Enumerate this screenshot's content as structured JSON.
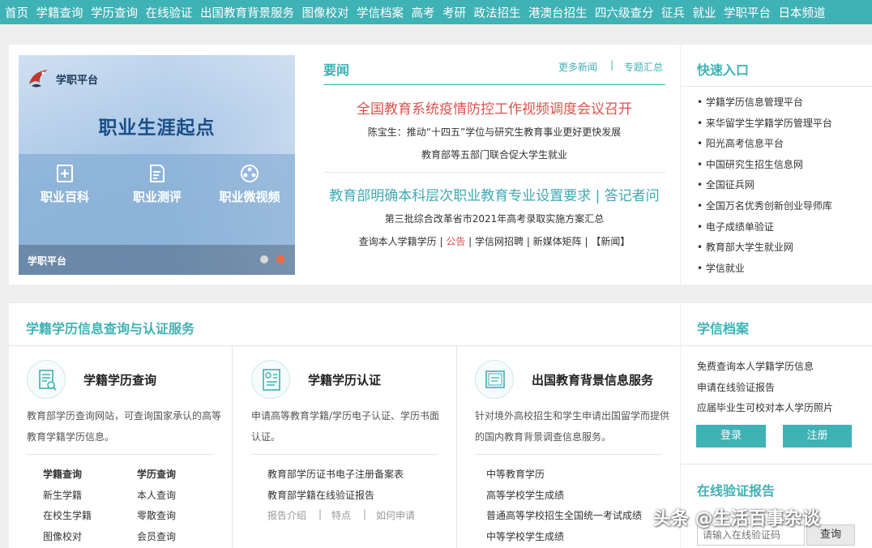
{
  "topnav": [
    "首页",
    "学籍查询",
    "学历查询",
    "在线验证",
    "出国教育背景服务",
    "图像校对",
    "学信档案",
    "高考",
    "考研",
    "政法招生",
    "港澳台招生",
    "四六级查分",
    "征兵",
    "就业",
    "学职平台",
    "日本频道"
  ],
  "banner": {
    "logo_text": "学职平台",
    "slogan": "职业生涯起点",
    "items": [
      "职业百科",
      "职业测评",
      "职业微视频"
    ],
    "footer": "学职平台"
  },
  "news": {
    "title": "要闻",
    "more": "更多新闻",
    "separator": "|",
    "topics": "专题汇总",
    "headline1": "全国教育系统疫情防控工作视频调度会议召开",
    "sub1": "陈宝生：推动“十四五”学位与研究生教育事业更好更快发展",
    "sub2": "教育部等五部门联合促大学生就业",
    "headline2": "教育部明确本科层次职业教育专业设置要求 | 答记者问",
    "sub3": "第三批综合改革省市2021年高考录取实施方案汇总",
    "links": [
      "查询本人学籍学历",
      " | ",
      "公告",
      " | 学信网招聘 | 新媒体矩阵 | ",
      "【新闻】"
    ]
  },
  "quick": {
    "title": "快速入口",
    "items": [
      "• 学籍学历信息管理平台",
      "• 来华留学生学籍学历管理平台",
      "• 阳光高考信息平台",
      "• 中国研究生招生信息网",
      "• 全国征兵网",
      "• 全国万名优秀创新创业导师库",
      "• 电子成绩单验证",
      "• 教育部大学生就业网",
      "• 学信就业"
    ]
  },
  "service": {
    "title": "学籍学历信息查询与认证服务",
    "cols": [
      {
        "title": "学籍学历查询",
        "desc": "教育部学历查询网站，可查询国家承认的高等教育学籍学历信息。",
        "links_a": [
          "学籍查询",
          "新生学籍",
          "在校生学籍",
          "图像校对"
        ],
        "links_b": [
          "学历查询",
          "本人查询",
          "零散查询",
          "会员查询"
        ]
      },
      {
        "title": "学籍学历认证",
        "desc": "申请高等教育学籍/学历电子认证、学历书面认证。",
        "links": [
          "教育部学历证书电子注册备案表",
          "教育部学籍在线验证报告"
        ],
        "sublinks": [
          "报告介绍",
          "|",
          "特点",
          "|",
          "如何申请"
        ]
      },
      {
        "title": "出国教育背景信息服务",
        "desc": "针对境外高校招生和学生申请出国留学而提供的国内教育背景调查信息服务。",
        "links": [
          "中等教育学历",
          "高等学校学生成绩",
          "普通高等学校招生全国统一考试成绩",
          "中等学校学生成绩"
        ]
      }
    ]
  },
  "archive": {
    "title": "学信档案",
    "items": [
      "免费查询本人学籍学历信息",
      "申请在线验证报告",
      "应届毕业生可校对本人学历照片"
    ],
    "login": "登录",
    "register": "注册"
  },
  "verify": {
    "title": "在线验证报告",
    "placeholder": "请输入在线验证码",
    "button": "查询"
  },
  "watermark": "头条 @生活百事杂谈",
  "colors": {
    "accent": "#3fb2b5",
    "red": "#d9534f",
    "dot_active": "#f06a3c"
  }
}
